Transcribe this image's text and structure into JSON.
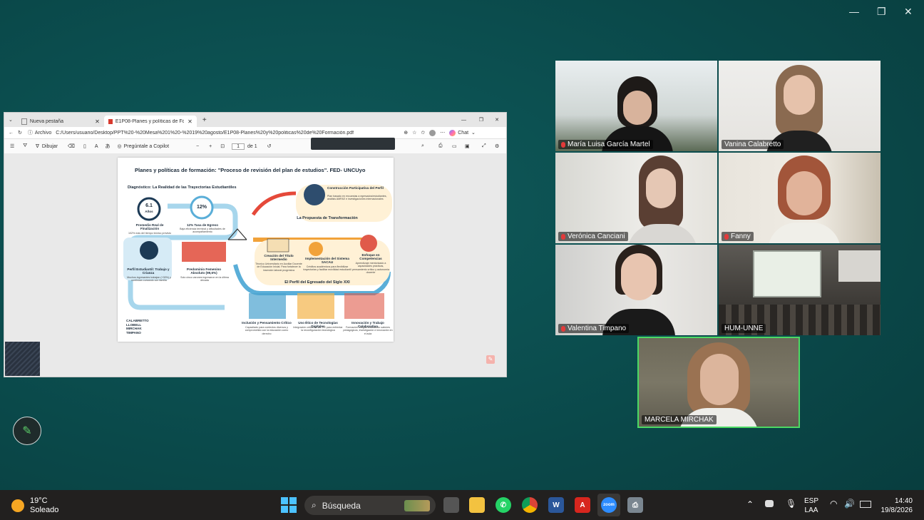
{
  "window_controls": {
    "minimize": "—",
    "restore": "❐",
    "close": "✕"
  },
  "browser": {
    "tabs": [
      {
        "label": "Nueva pestaña"
      },
      {
        "label": "E1P08-Planes y políticas de Forma"
      }
    ],
    "new_tab": "+",
    "address_prefix": "Archivo",
    "url": "C:/Users/usuario/Desktop/PPT%20-%20Mesa%201%20-%2019%20agosto/E1P08-Planes%20y%20politicas%20de%20Formación.pdf",
    "chat_label": "Chat",
    "toolbar": {
      "draw_label": "Dibujar",
      "copilot_label": "Pregúntale a Copilot",
      "page_current": "1",
      "page_total": "de 1",
      "zoom_out": "−",
      "zoom_in": "+"
    }
  },
  "slide": {
    "title": "Planes y políticas de formación: \"Proceso de revisión del plan de estudios\". FED- UNCUyo",
    "diagnostic_heading": "Diagnóstico: La Realidad de las Trayectorias Estudiantiles",
    "years_value": "6.1",
    "years_unit": "Años",
    "egress_value": "12%",
    "items": [
      {
        "title": "Promedio Real de Finalización",
        "sub": "102% más del tiempo teórico previsto"
      },
      {
        "title": "12% Tasa de Egreso",
        "sub": "Baja eficiencia terminal y dificultades de acompañamiento"
      },
      {
        "title": "Perfil Estudiantil: Trabajo y Crianza",
        "sub": "Muchos ingresantes trabajan (+30%) y continúan cursando con familia"
      },
      {
        "title": "Predominio Femenino Absoluto (99,6%)",
        "sub": "Solo cinco varones ingresaron en la última década"
      },
      {
        "title": "Construcción Participativa del Perfil",
        "sub": "Plan basado en encuestas a egresados/estudiantes, análisis AMFAE e investigaciones internacionales"
      },
      {
        "title": "Creación del Título Intermedio",
        "sub": "Técnico Universitario en Auxiliar Docente de Educación Inicial. Para fortalecer la inserción laboral progresiva"
      },
      {
        "title": "Implementación del Sistema SACAU",
        "sub": "Créditos académicos para flexibilizar trayectorias y facilitar movilidad estudiantil"
      },
      {
        "title": "Enfoque en Competencias",
        "sub": "Aprendizaje mentorizado a capacidades prácticas, pensamiento crítico y autonomía docente"
      },
      {
        "title": "Inclusión y Pensamiento Crítico",
        "sub": "Capacitado para contextos diversos y comprometido con la educación como derecho"
      },
      {
        "title": "Uso Ético de Tecnologías Digitales",
        "sub": "Integración crítica de las TIC para enfrentar la reconfiguración tecnológica"
      },
      {
        "title": "Innovación y Trabajo Colaborativo",
        "sub": "Formación integral articulando saberes pedagógicos, investigación e innovación en el aula"
      }
    ],
    "proposal_heading": "La Propuesta de Transformación",
    "profile_heading": "El Perfil del Egresado del Siglo XXI",
    "authors": [
      "CALABRETTO",
      "LLOBELL",
      "MIRCHAK",
      "TIMPANO"
    ]
  },
  "participants": [
    {
      "name": "María Luisa García Martel",
      "muted": true
    },
    {
      "name": "Vanina Calabretto",
      "muted": false
    },
    {
      "name": "Verónica Canciani",
      "muted": true
    },
    {
      "name": "Fanny",
      "muted": true
    },
    {
      "name": "Valentina Timpano",
      "muted": true
    },
    {
      "name": "HUM-UNNE",
      "muted": false
    },
    {
      "name": "MARCELA MIRCHAK",
      "muted": false,
      "speaking": true
    }
  ],
  "taskbar": {
    "weather_temp": "19°C",
    "weather_desc": "Soleado",
    "search_label": "Búsqueda",
    "lang_top": "ESP",
    "lang_bottom": "LAA",
    "time": "14:40",
    "date": "19/8/2026"
  },
  "colors": {
    "speaking_border": "#4cd964",
    "accent_orange": "#f39c12",
    "accent_blue": "#5aaed8"
  }
}
